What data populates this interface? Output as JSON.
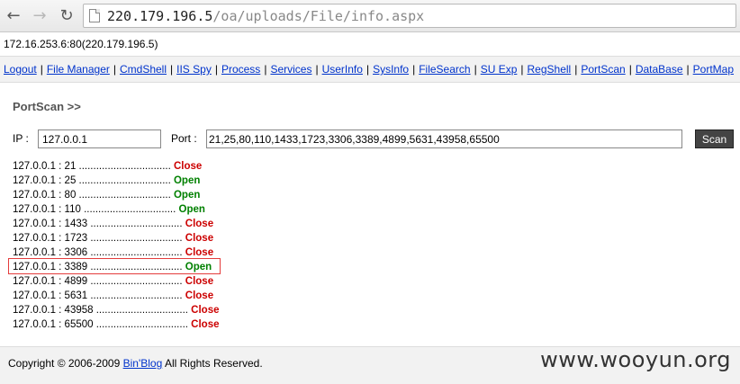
{
  "browser": {
    "url_host": "220.179.196.5",
    "url_path": "/oa/uploads/File/info.aspx"
  },
  "host_line": "172.16.253.6:80(220.179.196.5)",
  "menu": [
    "Logout",
    "File Manager",
    "CmdShell",
    "IIS Spy",
    "Process",
    "Services",
    "UserInfo",
    "SysInfo",
    "FileSearch",
    "SU Exp",
    "RegShell",
    "PortScan",
    "DataBase",
    "PortMap"
  ],
  "portscan": {
    "title": "PortScan >>",
    "ip_label": "IP :",
    "ip_value": "127.0.0.1",
    "port_label": "Port :",
    "port_value": "21,25,80,110,1433,1723,3306,3389,4899,5631,43958,65500",
    "scan_label": "Scan"
  },
  "results": [
    {
      "prefix": "127.0.0.1 : 21 ................................",
      "status": "Close"
    },
    {
      "prefix": "127.0.0.1 : 25 ................................",
      "status": "Open"
    },
    {
      "prefix": "127.0.0.1 : 80 ................................",
      "status": "Open"
    },
    {
      "prefix": "127.0.0.1 : 110 ................................",
      "status": "Open"
    },
    {
      "prefix": "127.0.0.1 : 1433 ................................",
      "status": "Close"
    },
    {
      "prefix": "127.0.0.1 : 1723 ................................",
      "status": "Close"
    },
    {
      "prefix": "127.0.0.1 : 3306 ................................",
      "status": "Close"
    },
    {
      "prefix": "127.0.0.1 : 3389 ................................",
      "status": "Open"
    },
    {
      "prefix": "127.0.0.1 : 4899 ................................",
      "status": "Close"
    },
    {
      "prefix": "127.0.0.1 : 5631 ................................",
      "status": "Close"
    },
    {
      "prefix": "127.0.0.1 : 43958 ................................",
      "status": "Close"
    },
    {
      "prefix": "127.0.0.1 : 65500 ................................",
      "status": "Close"
    }
  ],
  "footer": {
    "copyright_prefix": "Copyright © 2006-2009",
    "link": "Bin'Blog",
    "copyright_suffix": "All Rights Reserved."
  },
  "watermark": "www.wooyun.org",
  "colors": {
    "open": "#008000",
    "close": "#cc0000",
    "link": "#0033cc",
    "highlight": "#e43c3c"
  }
}
